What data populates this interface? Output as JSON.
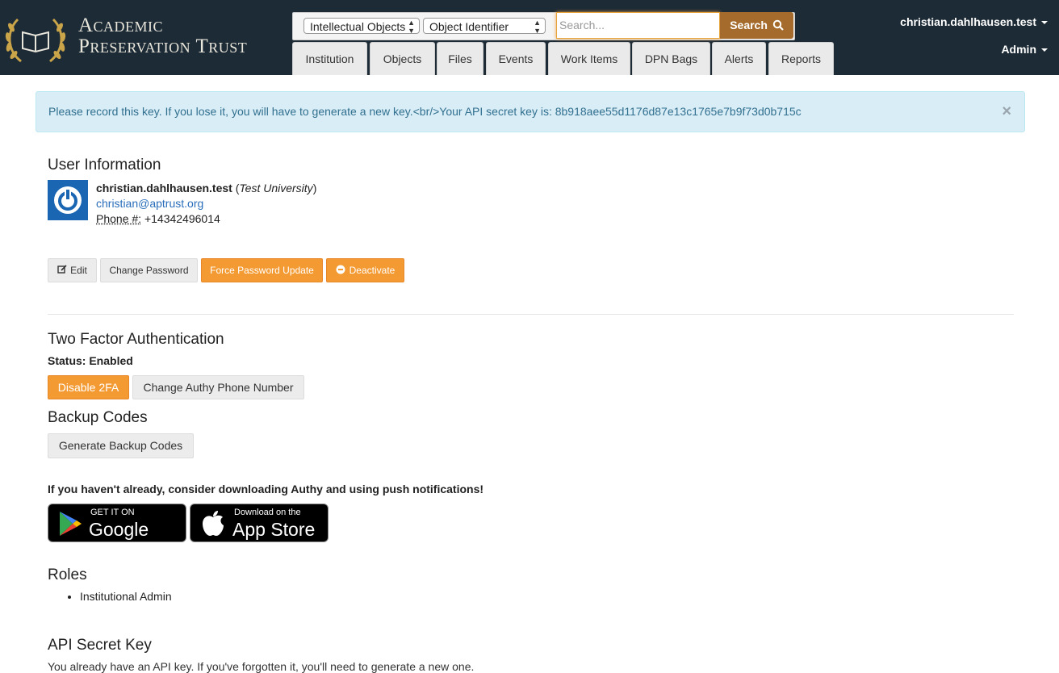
{
  "header": {
    "brand_line1": "Academic",
    "brand_line2": "Preservation Trust",
    "search": {
      "type_select": "Intellectual Objects",
      "field_select": "Object Identifier",
      "placeholder": "Search...",
      "button_label": "Search"
    },
    "tabs": [
      "Institution",
      "Objects",
      "Files",
      "Events",
      "Work Items",
      "DPN Bags",
      "Alerts",
      "Reports"
    ],
    "user_menu": "christian.dahlhausen.test",
    "admin_menu": "Admin"
  },
  "alert": {
    "message": "Please record this key. If you lose it, you will have to generate a new key.<br/>Your API secret key is: 8b918aee55d1176d87e13c1765e7b9f73d0b715c",
    "close": "×"
  },
  "user_info": {
    "heading": "User Information",
    "username": "christian.dahlhausen.test",
    "institution": "Test University",
    "email": "christian@aptrust.org",
    "phone_label": "Phone #:",
    "phone": "+14342496014"
  },
  "actions": {
    "edit": "Edit",
    "change_password": "Change Password",
    "force_password_update": "Force Password Update",
    "deactivate": "Deactivate"
  },
  "two_factor": {
    "heading": "Two Factor Authentication",
    "status": "Status: Enabled",
    "disable": "Disable 2FA",
    "change_phone": "Change Authy Phone Number"
  },
  "backup": {
    "heading": "Backup Codes",
    "generate": "Generate Backup Codes"
  },
  "authy_note": "If you haven't already, consider downloading Authy and using push notifications!",
  "stores": {
    "google_small": "GET IT ON",
    "google_big": "Google Play",
    "apple_small": "Download on the",
    "apple_big": "App Store"
  },
  "roles": {
    "heading": "Roles",
    "items": [
      "Institutional Admin"
    ]
  },
  "api": {
    "heading": "API Secret Key",
    "text": "You already have an API key. If you've forgotten it, you'll need to generate a new one."
  },
  "colors": {
    "topbar": "#1d2b36",
    "search_button": "#a46b2c",
    "orange_button": "#f39a32",
    "alert_bg": "#d9edf7",
    "link": "#2a6ebb"
  }
}
